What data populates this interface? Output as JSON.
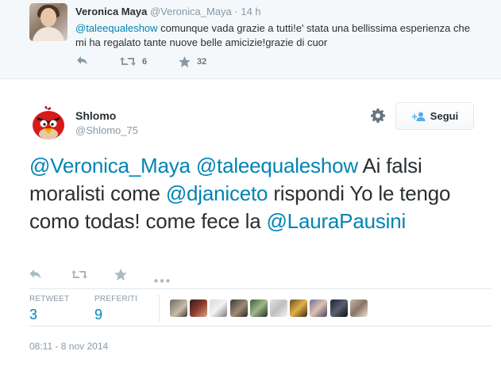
{
  "parent_tweet": {
    "name": "Veronica Maya",
    "handle": "@Veronica_Maya",
    "dot": "·",
    "time": "14 h",
    "mention": "@taleequaleshow",
    "text_rest": " comunque vada grazie a tutti!e' stata una bellissima esperienza che mi ha regalato tante nuove belle amicizie!grazie di cuor",
    "retweet_count": "6",
    "favorite_count": "32"
  },
  "main_tweet": {
    "name": "Shlomo",
    "handle": "@Shlomo_75",
    "follow_label": "Segui",
    "text": {
      "m1": "@Veronica_Maya",
      "s1": " ",
      "m2": "@taleequaleshow",
      "t1": " Ai falsi moralisti come ",
      "m3": "@djaniceto",
      "t2": " rispondi Yo le tengo como todas! come fece la ",
      "m4": "@LauraPausini"
    },
    "stats": {
      "retweet_label": "RETWEET",
      "retweet_value": "3",
      "favorites_label": "PREFERITI",
      "favorites_value": "9"
    },
    "date": "08:11 - 8 nov 2014"
  },
  "icons": {
    "reply": "reply-icon",
    "retweet": "retweet-icon",
    "favorite": "star-icon",
    "more": "more-icon",
    "gear": "gear-icon",
    "follow": "add-user-icon"
  },
  "colors": {
    "link": "#0084b4",
    "muted": "#8899a6",
    "text": "#292f33",
    "border": "#e1e8ed",
    "parent_bg": "#f5f8fa"
  }
}
